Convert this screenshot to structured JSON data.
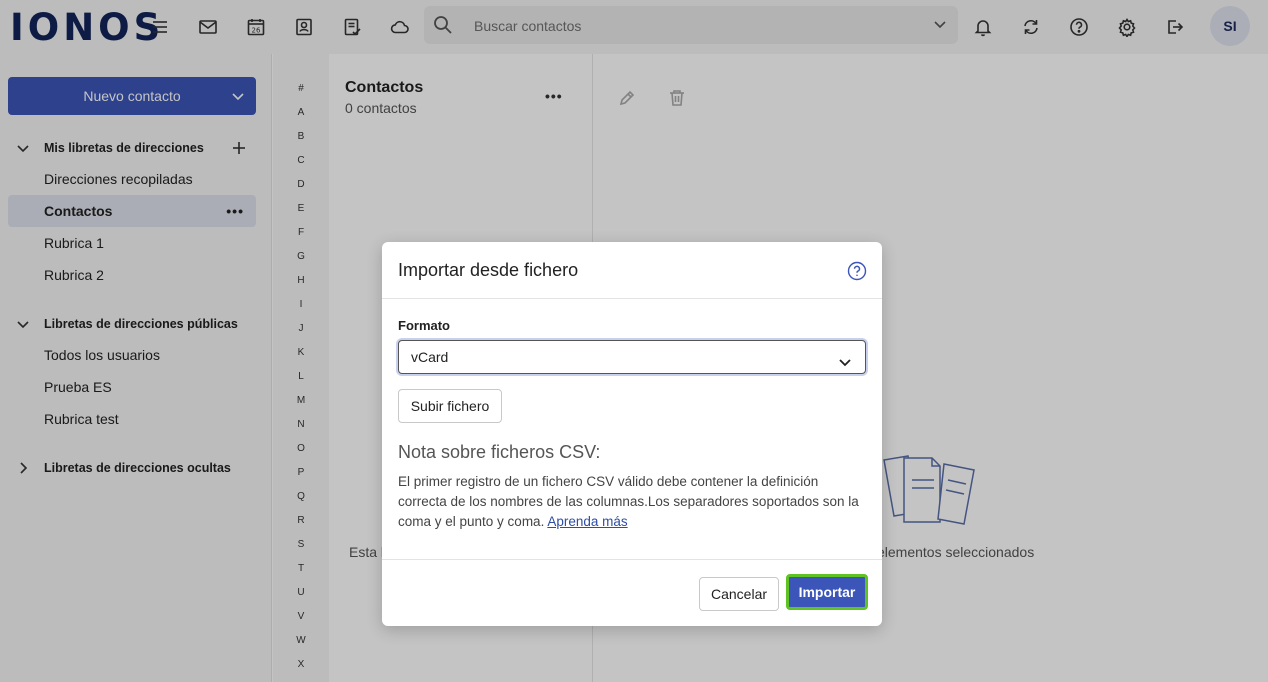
{
  "app": {
    "logo": "IONOS"
  },
  "topbar": {
    "icons": [
      "menu-icon",
      "mail-icon",
      "calendar-icon",
      "contacts-icon",
      "tasks-icon",
      "cloud-icon",
      "bell-icon",
      "refresh-icon",
      "help-icon",
      "settings-icon",
      "logout-icon"
    ],
    "calendar_day": "26",
    "search_placeholder": "Buscar contactos",
    "avatar_initials": "SI"
  },
  "sidebar": {
    "new_contact_label": "Nuevo contacto",
    "sections": [
      {
        "title": "Mis libretas de direcciones",
        "expanded": true,
        "items": [
          "Direcciones recopiladas",
          "Contactos",
          "Rubrica 1",
          "Rubrica 2"
        ]
      },
      {
        "title": "Libretas de direcciones públicas",
        "expanded": true,
        "items": [
          "Todos los usuarios",
          "Prueba ES",
          "Rubrica test"
        ]
      },
      {
        "title": "Libretas de direcciones ocultas",
        "expanded": false,
        "items": []
      }
    ],
    "selected_item": "Contactos"
  },
  "alphabet": [
    "#",
    "A",
    "B",
    "C",
    "D",
    "E",
    "F",
    "G",
    "H",
    "I",
    "J",
    "K",
    "L",
    "M",
    "N",
    "O",
    "P",
    "Q",
    "R",
    "S",
    "T",
    "U",
    "V",
    "W",
    "X"
  ],
  "list": {
    "title": "Contactos",
    "count": "0 contactos",
    "empty_text_visible": "Esta l"
  },
  "detail": {
    "empty_text_visible": "elementos seleccionados"
  },
  "modal": {
    "title": "Importar desde fichero",
    "format_label": "Formato",
    "format_value": "vCard",
    "upload_label": "Subir fichero",
    "note_title": "Nota sobre ficheros CSV:",
    "note_text": "El primer registro de un fichero CSV válido debe contener la definición correcta de los nombres de las columnas.Los separadores soportados son la coma y el punto y coma. ",
    "note_link": "Aprenda más",
    "cancel_label": "Cancelar",
    "import_label": "Importar"
  },
  "colors": {
    "primary": "#3b55b8",
    "highlight": "#5ec323",
    "logo": "#11245a"
  }
}
